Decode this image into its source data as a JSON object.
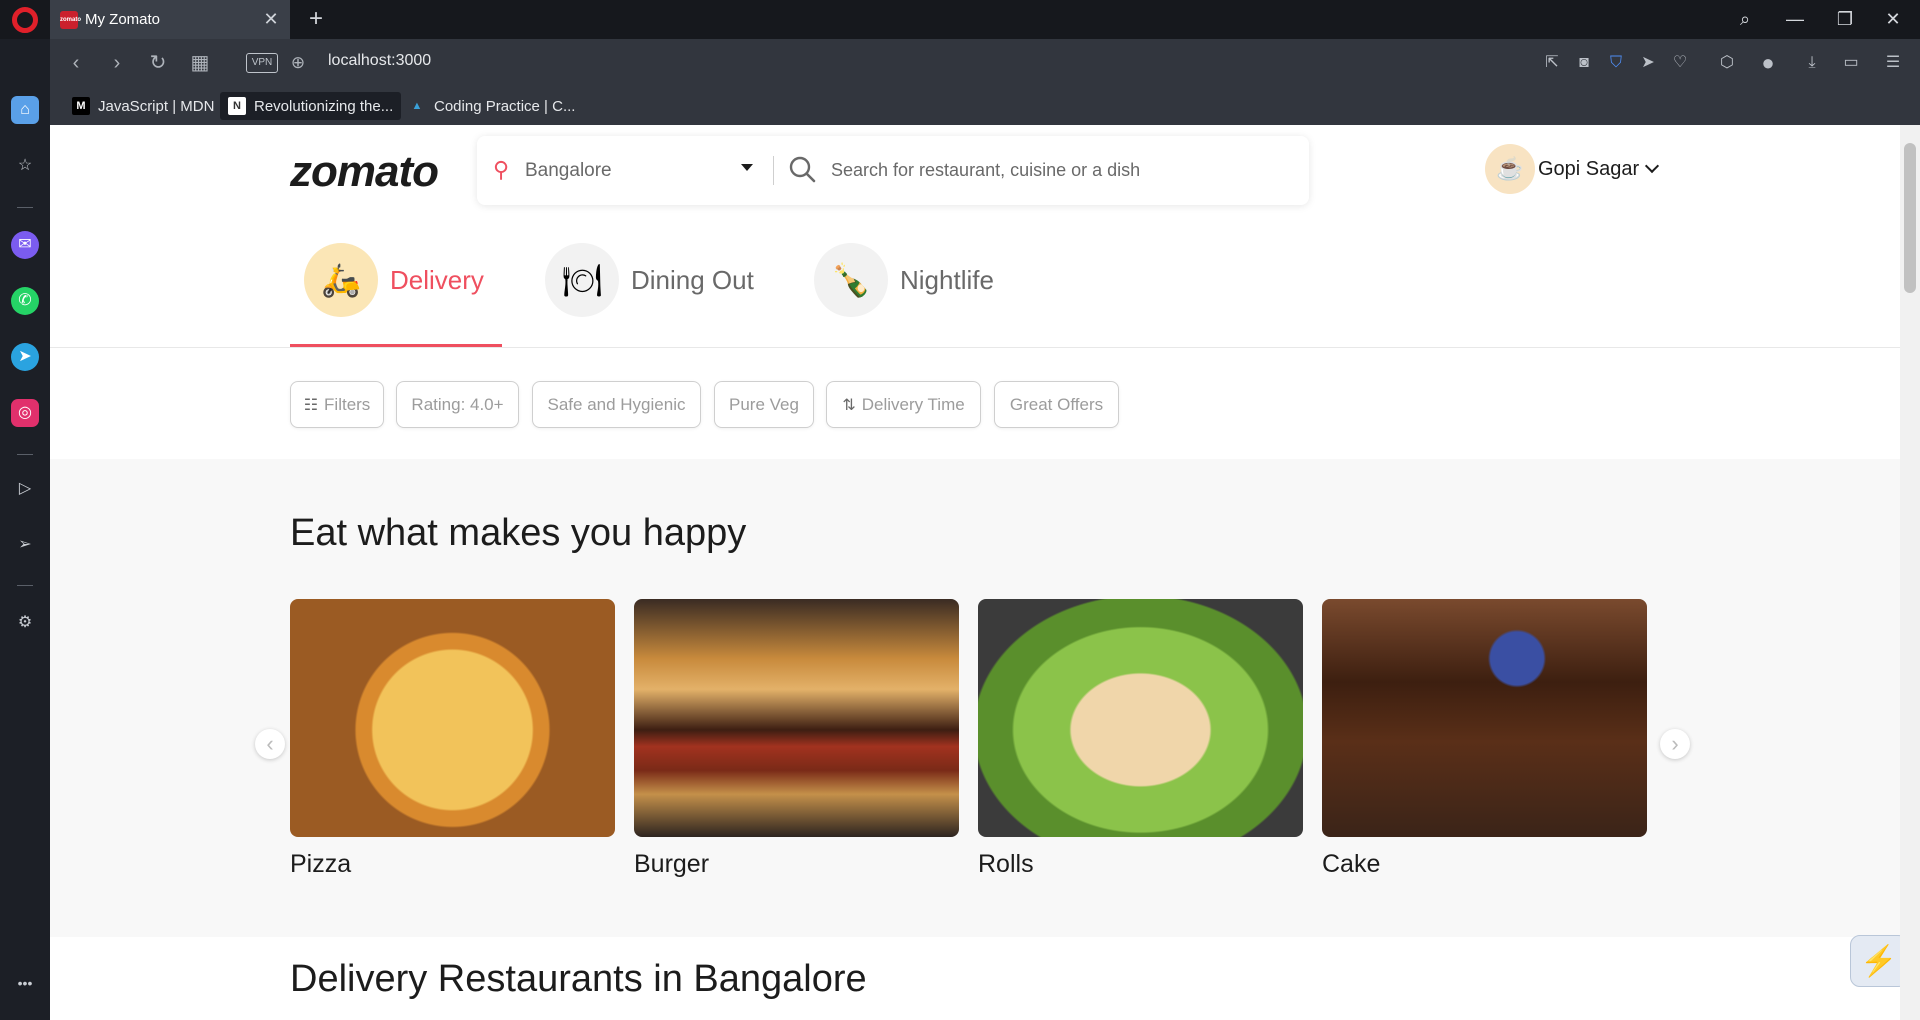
{
  "browser": {
    "tab_title": "My Zomato",
    "tab_favicon_text": "zomato",
    "url": "localhost:3000",
    "vpn_label": "VPN",
    "bookmarks": [
      {
        "label": "JavaScript | MDN",
        "icon": "M"
      },
      {
        "label": "Revolutionizing the...",
        "icon": "N"
      },
      {
        "label": "Coding Practice | C...",
        "icon": "▲"
      }
    ]
  },
  "header": {
    "logo": "zomato",
    "location": "Bangalore",
    "search_placeholder": "Search for restaurant, cuisine or a dish",
    "user_name": "Gopi Sagar"
  },
  "categories": [
    {
      "label": "Delivery",
      "icon": "🛵",
      "active": true
    },
    {
      "label": "Dining Out",
      "icon": "🍽",
      "active": false
    },
    {
      "label": "Nightlife",
      "icon": "🍾",
      "active": false
    }
  ],
  "filters": [
    {
      "label": "Filters",
      "icon": "☷"
    },
    {
      "label": "Rating: 4.0+"
    },
    {
      "label": "Safe and Hygienic"
    },
    {
      "label": "Pure Veg"
    },
    {
      "label": "Delivery Time",
      "icon": "⇅"
    },
    {
      "label": "Great Offers"
    }
  ],
  "section": {
    "heading": "Eat what makes you happy",
    "foods": [
      {
        "name": "Pizza"
      },
      {
        "name": "Burger"
      },
      {
        "name": "Rolls"
      },
      {
        "name": "Cake"
      }
    ]
  },
  "restaurants_heading": "Delivery Restaurants in Bangalore",
  "colors": {
    "accent": "#ef4f5f",
    "delivery_icon_bg": "#fbe6b6"
  }
}
